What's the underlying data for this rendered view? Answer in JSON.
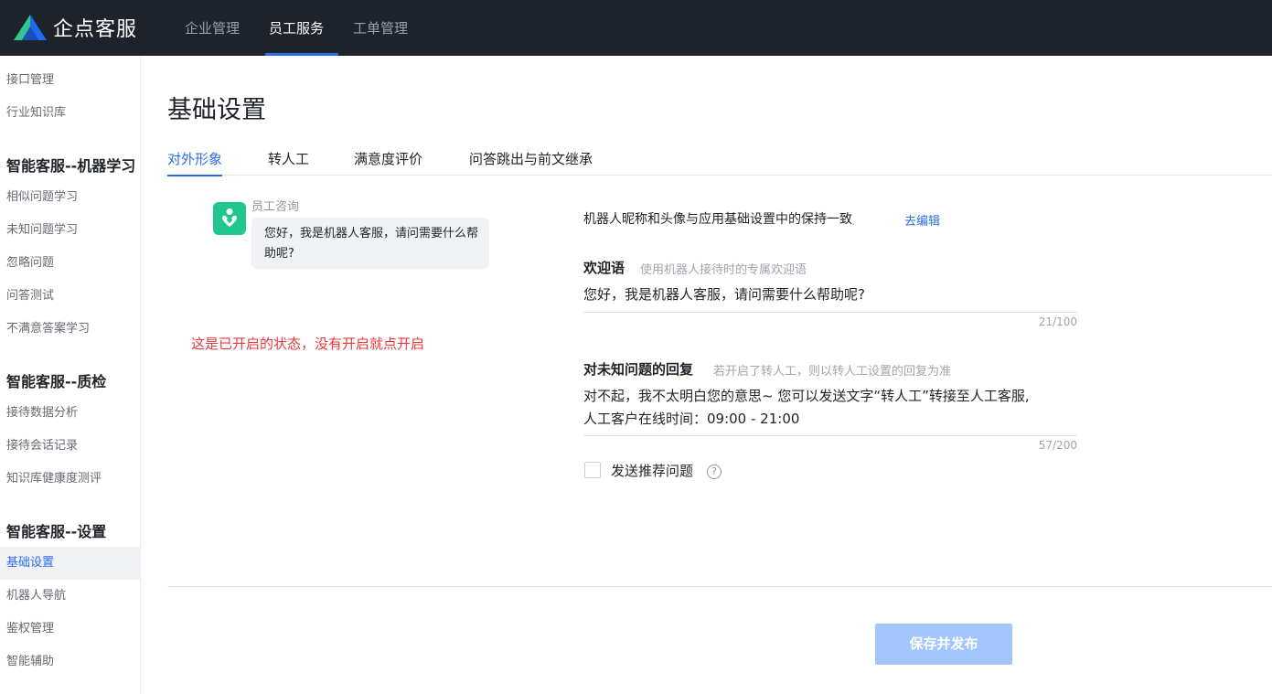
{
  "app": {
    "brand_name": "企点客服",
    "accent_color": "#2b6de8",
    "brand_icon": "qidian-logo-icon"
  },
  "topnav": {
    "items": [
      {
        "label": "企业管理",
        "active": false
      },
      {
        "label": "员工服务",
        "active": true
      },
      {
        "label": "工单管理",
        "active": false
      }
    ]
  },
  "sidebar": {
    "top_items": [
      {
        "label": "接口管理"
      },
      {
        "label": "行业知识库"
      }
    ],
    "groups": [
      {
        "title": "智能客服--机器学习",
        "items": [
          {
            "label": "相似问题学习"
          },
          {
            "label": "未知问题学习"
          },
          {
            "label": "忽略问题"
          },
          {
            "label": "问答测试"
          },
          {
            "label": "不满意答案学习"
          }
        ]
      },
      {
        "title": "智能客服--质检",
        "items": [
          {
            "label": "接待数据分析"
          },
          {
            "label": "接待会话记录"
          },
          {
            "label": "知识库健康度测评"
          }
        ]
      },
      {
        "title": "智能客服--设置",
        "items": [
          {
            "label": "基础设置",
            "active": true
          },
          {
            "label": "机器人导航"
          },
          {
            "label": "鉴权管理"
          },
          {
            "label": "智能辅助"
          }
        ]
      }
    ]
  },
  "main": {
    "title": "基础设置",
    "tabs": [
      {
        "label": "对外形象",
        "active": true
      },
      {
        "label": "转人工"
      },
      {
        "label": "满意度评价"
      },
      {
        "label": "问答跳出与前文继承"
      }
    ],
    "preview": {
      "bot_name": "员工咨询",
      "bot_avatar_icon": "robot-avatar-icon",
      "bubble_text": "您好，我是机器人客服，请问需要什么帮助呢?"
    },
    "annotation": "这是已开启的状态，没有开启就点开启",
    "sync_text": "机器人昵称和头像与应用基础设置中的保持一致",
    "edit_link": "去编辑",
    "welcome": {
      "label": "欢迎语",
      "hint": "使用机器人接待时的专属欢迎语",
      "value": "您好，我是机器人客服，请问需要什么帮助呢?",
      "counter": "21/100"
    },
    "unknown_reply": {
      "label": "对未知问题的回复",
      "hint": "若开启了转人工，则以转人工设置的回复为准",
      "value_line1": "对不起，我不太明白您的意思~ 您可以发送文字“转人工”转接至人工客服,",
      "value_line2": "人工客户在线时间：09:00 - 21:00",
      "counter": "57/200"
    },
    "recommend": {
      "label": "发送推荐问题",
      "checked": false,
      "help_icon": "question-circle-icon"
    },
    "save_button": "保存并发布"
  }
}
